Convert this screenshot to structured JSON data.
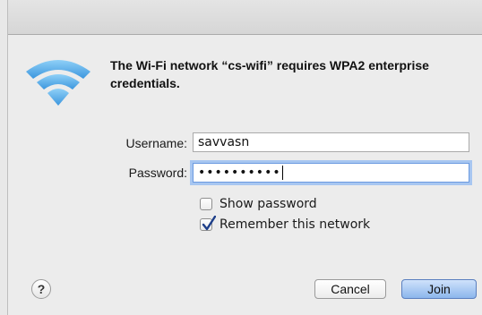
{
  "dialog": {
    "message": "The Wi-Fi network “cs-wifi” requires WPA2 enterprise credentials.",
    "icon": "wifi-icon"
  },
  "form": {
    "username_label": "Username:",
    "username_value": "savvasn",
    "password_label": "Password:",
    "password_value": "••••••••••"
  },
  "options": {
    "show_password_label": "Show password",
    "show_password_checked": false,
    "remember_label": "Remember this network",
    "remember_checked": true
  },
  "buttons": {
    "help_label": "?",
    "cancel_label": "Cancel",
    "join_label": "Join"
  },
  "colors": {
    "wifi_blue": "#5aa9e6",
    "focus_ring": "#a7c6f1",
    "default_button": "#8cb6ec"
  }
}
